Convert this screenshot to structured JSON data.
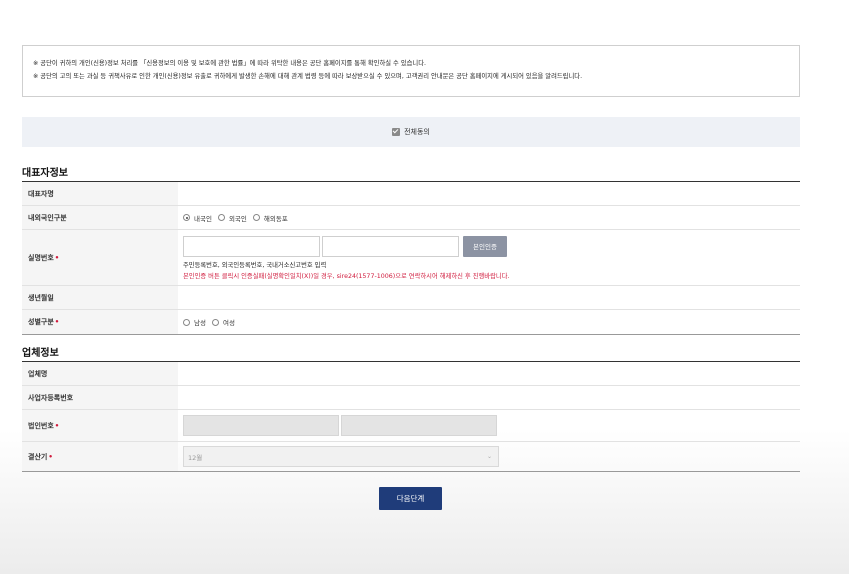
{
  "notice": {
    "line1": "※ 공단이 귀하의 개인(신용)정보 처리를 「신용정보의 이용 및 보호에 관한 법률」에 따라 위탁한 내용은 공단 홈페이지를 통해 확인하실 수 있습니다.",
    "line2": "※ 공단의 고의 또는 과실 등 귀책사유로 인한 개인(신용)정보 유출로 귀하에게 발생한 손해에 대해 관계 법령 등에 따라 보상받으실 수 있으며, 고객권리 안내문은 공단 홈페이지에 게시되어 있음을 알려드립니다."
  },
  "agree_all": {
    "label": "전체동의",
    "checked": true
  },
  "rep_section": {
    "title": "대표자정보",
    "rows": {
      "name": {
        "label": "대표자명"
      },
      "nationality": {
        "label": "내외국인구분",
        "options": [
          "내국인",
          "외국인",
          "해외동포"
        ],
        "selected": "내국인"
      },
      "realname": {
        "label": "실명번호",
        "verify_button": "본인인증",
        "help": "주민등록번호, 외국인등록번호, 국내거소신고번호 입력",
        "warning": "본인인증 버튼 클릭시 인증실패(실명확인일치(X))일 경우, sire24(1577-1006)으로 연락하시어 해제하신 후 진행바랍니다."
      },
      "birth": {
        "label": "생년월일"
      },
      "gender": {
        "label": "성별구분",
        "options": [
          "남성",
          "여성"
        ]
      }
    }
  },
  "biz_section": {
    "title": "업체정보",
    "rows": {
      "company": {
        "label": "업체명"
      },
      "bizno": {
        "label": "사업자등록번호"
      },
      "corpno": {
        "label": "법인번호"
      },
      "fiscal": {
        "label": "결산기",
        "value": "12월"
      }
    }
  },
  "next_button": "다음단계",
  "colors": {
    "required": "#d01a3c",
    "primary": "#1f3c7a",
    "verify": "#8c93a3"
  }
}
